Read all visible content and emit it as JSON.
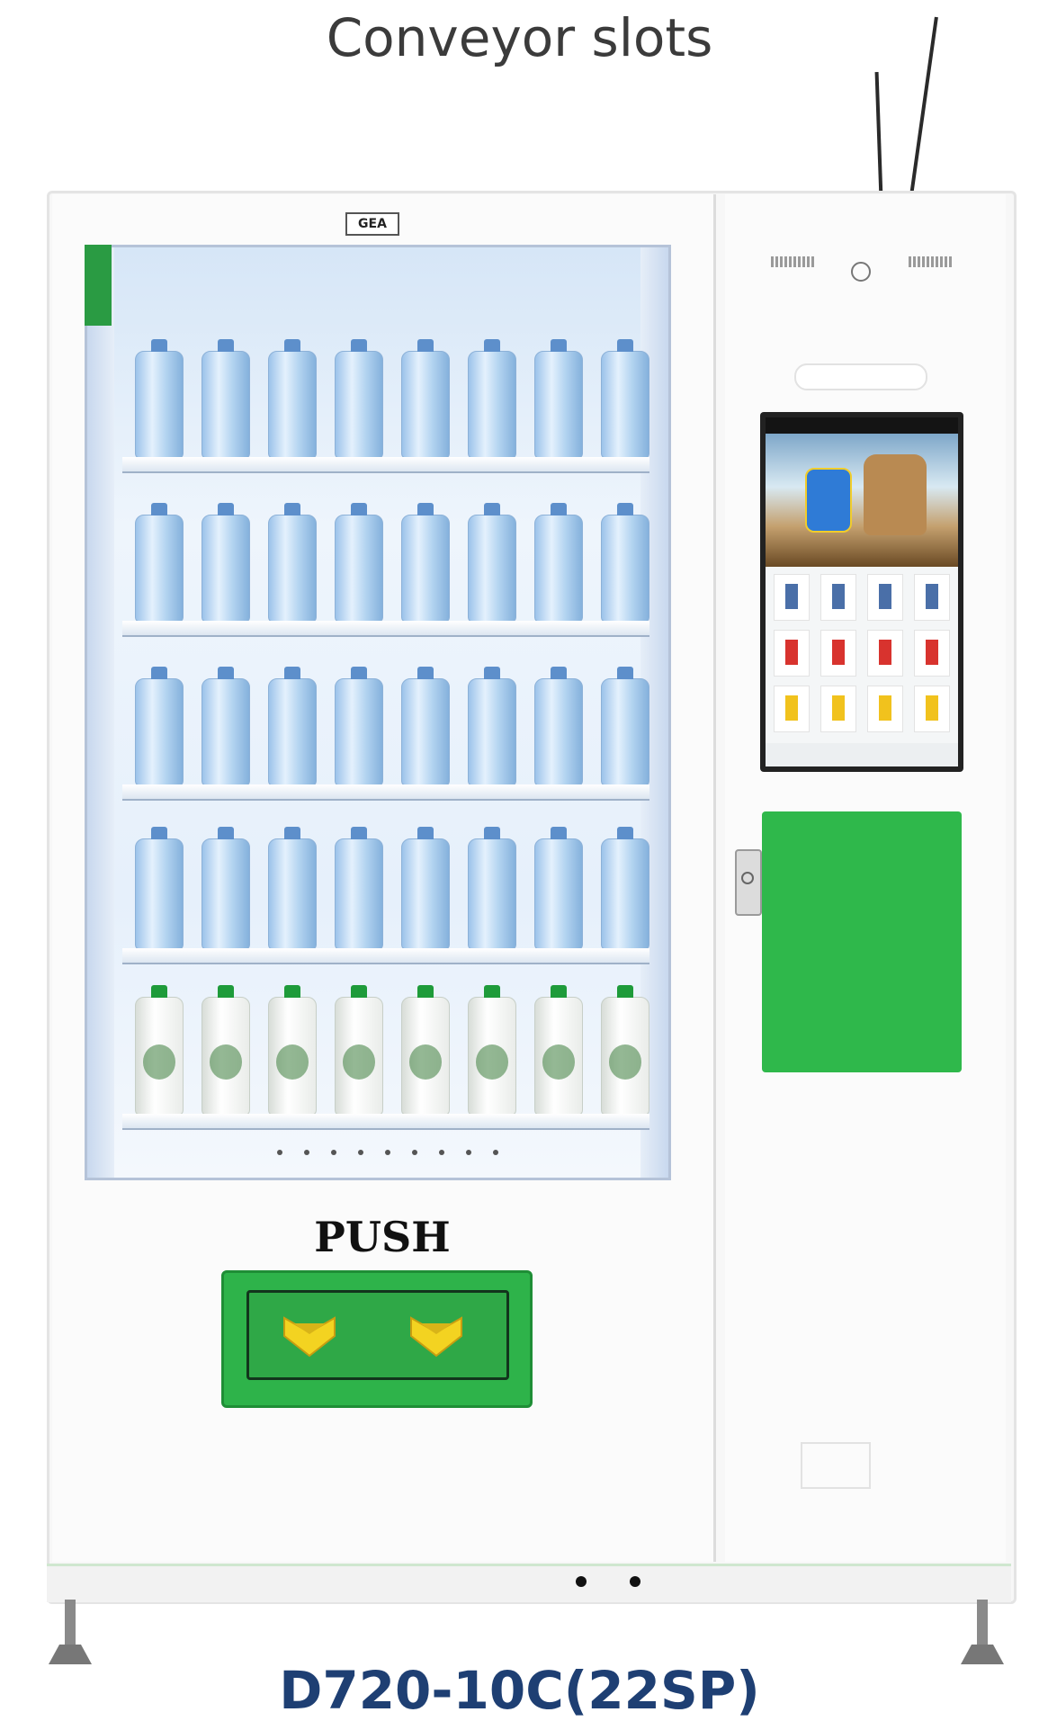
{
  "caption": "Conveyor slots",
  "model": "D720-10C(22SP)",
  "badge_text": "GEA",
  "push_label": "PUSH",
  "colors": {
    "accent_green": "#2fb84b",
    "model_text": "#1e3f73",
    "chevron_yellow": "#f3d321"
  },
  "shelves": [
    {
      "product": "water-bottle",
      "count": 8
    },
    {
      "product": "water-bottle",
      "count": 8
    },
    {
      "product": "water-bottle",
      "count": 8
    },
    {
      "product": "water-bottle",
      "count": 8
    },
    {
      "product": "green-cap-bottle",
      "count": 8
    }
  ],
  "icons": {
    "speaker_grilles": "speaker-grille-icon",
    "camera": "camera-icon",
    "push_arrows": "chevron-down-icon",
    "lock": "lock-icon"
  }
}
